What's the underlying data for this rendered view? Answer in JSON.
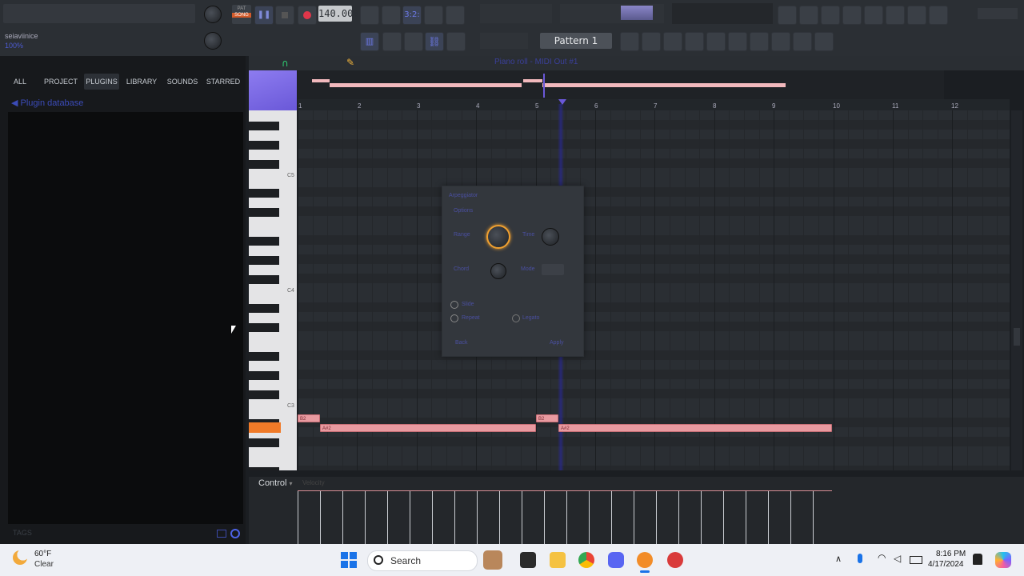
{
  "toolbar": {
    "hint_text": "",
    "user_name": "seiaviinice",
    "zoom": "100%",
    "mode_pat": "PAT",
    "mode_song": "SONG",
    "tempo": "140.000",
    "pattern": "Pattern 1",
    "step_display": "3:2:"
  },
  "browser": {
    "tabs": [
      "ALL",
      "PROJECT",
      "PLUGINS",
      "LIBRARY",
      "SOUNDS",
      "STARRED"
    ],
    "active_tab": "PLUGINS",
    "tree_root": "Plugin database",
    "tags_label": "TAGS"
  },
  "piano_roll": {
    "title": "Piano roll - MIDI Out #1",
    "bar_numbers": [
      "1",
      "2",
      "3",
      "4",
      "5",
      "6",
      "7",
      "8",
      "9",
      "10",
      "11",
      "12"
    ],
    "octave_labels": [
      "C5",
      "C4",
      "C3"
    ],
    "notes": [
      "B2",
      "A#2",
      "B2",
      "A#2"
    ],
    "control_label": "Control",
    "velocity_label": "Velocity"
  },
  "dialog": {
    "title": "Arpeggiator",
    "labels": [
      "Options",
      "Range",
      "Time",
      "Chord",
      "Mode",
      "Slide",
      "Repeat",
      "Legato",
      "Back",
      "Apply"
    ]
  },
  "taskbar": {
    "weather_temp": "60°F",
    "weather_cond": "Clear",
    "search_placeholder": "Search",
    "time": "8:16 PM",
    "date": "4/17/2024"
  },
  "colors": {
    "accent": "#8d7cf0",
    "note": "#e89aa0",
    "active_key": "#f07a28"
  }
}
